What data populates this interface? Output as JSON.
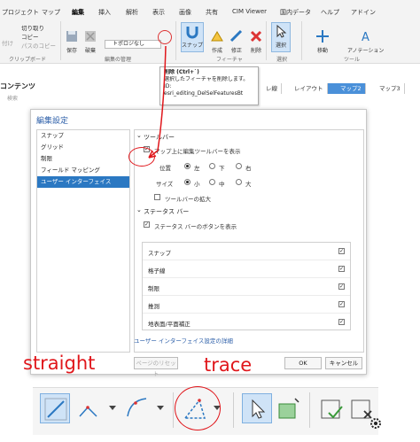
{
  "ribbon": {
    "tabs": [
      "プロジェクト",
      "マップ",
      "編集",
      "挿入",
      "解析",
      "表示",
      "画像",
      "共有",
      "CIM Viewer",
      "国内データ",
      "ヘルプ",
      "アドイン"
    ],
    "active_tab": "編集",
    "cut": "切り取り",
    "copy": "コピー",
    "paste_path": "パスのコピー",
    "paste_label": "付け",
    "save": "保存",
    "discard": "破棄",
    "topology_combo": "トポロジなし",
    "snap": "スナップ",
    "create": "作成",
    "modify": "修正",
    "delete": "削除",
    "select": "選択",
    "move": "移動",
    "annotation": "アノテーション",
    "group_clipboard": "クリップボード",
    "group_manage": "編集の管理",
    "group_feature": "フィーチャ",
    "group_selection": "選択",
    "group_tools": "ツール"
  },
  "tooltip": {
    "title": "削除 (Ctrl+`)",
    "desc": "選択したフィーチャを削除します。",
    "id_label": "ID:",
    "id_value": "esri_editing_DelSelFeaturesBt"
  },
  "contents": {
    "title": "コンテンツ",
    "search_placeholder": "検索"
  },
  "map_tabs": [
    "レ線",
    "レイアウト",
    "マップ2",
    "マップ3"
  ],
  "map_tabs_active": 2,
  "dialog": {
    "title": "編集設定",
    "nav": [
      "スナップ",
      "グリッド",
      "制限",
      "フィールド マッピング",
      "ユーザー インターフェイス"
    ],
    "nav_selected": 4,
    "toolbar_section": "ツールバー",
    "show_toolbar": "マップ上に編集ツールバーを表示",
    "position_label": "位置",
    "position_options": [
      "左",
      "下",
      "右"
    ],
    "size_label": "サイズ",
    "size_options": [
      "小",
      "中",
      "大"
    ],
    "magnify": "ツールバーの拡大",
    "statusbar_section": "ステータス バー",
    "show_status_buttons": "ステータス バーのボタンを表示",
    "status_items": [
      "スナップ",
      "格子線",
      "制限",
      "推測",
      "地表面/平面補正"
    ],
    "ui_link": "ユーザー インターフェイス設定の詳細",
    "reset_button": "ページのリセット",
    "ok_button": "OK",
    "cancel_button": "キャンセル"
  },
  "annotations": {
    "straight": "straight",
    "trace": "trace",
    "color": "#e0161b"
  },
  "colors": {
    "accent": "#2b78c2",
    "active_map_tab": "#4a90d9",
    "selection": "#cfe3f7"
  },
  "icons": {
    "toolbar": [
      "line-segment-icon",
      "right-angle-icon",
      "arc-icon",
      "trace-icon",
      "pointer-icon",
      "vertices-icon",
      "finish-sketch-icon",
      "delete-sketch-icon",
      "gear-icon"
    ]
  }
}
